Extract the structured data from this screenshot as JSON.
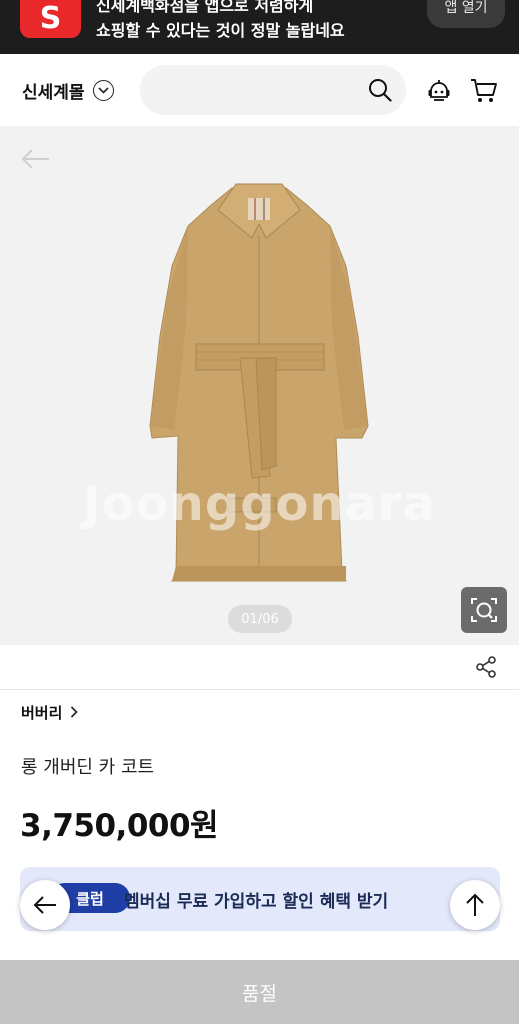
{
  "app_banner": {
    "logo_letter": "S",
    "line1": "신세계백화점을 앱으로 저렴하게",
    "line2": "쇼핑할 수 있다는 것이 정말 놀랍네요",
    "open_button": "앱 열기",
    "brand_color": "#e8282a"
  },
  "header": {
    "mall_name": "신세계몰",
    "search_placeholder": "",
    "icons": [
      "chevron-down-icon",
      "search-icon",
      "chatbot-icon",
      "cart-icon"
    ]
  },
  "gallery": {
    "watermark": "Joonggonara",
    "counter": "01/06",
    "current_index": 1,
    "total": 6
  },
  "product": {
    "brand": "버버리",
    "name": "롱 개버딘 카 코트",
    "price": "3,750,000원"
  },
  "membership": {
    "badge": "클럽",
    "text": "멤버십 무료 가입하고 할인 혜택 받기",
    "accent": "#1f3fa6"
  },
  "footer": {
    "status": "품절"
  }
}
